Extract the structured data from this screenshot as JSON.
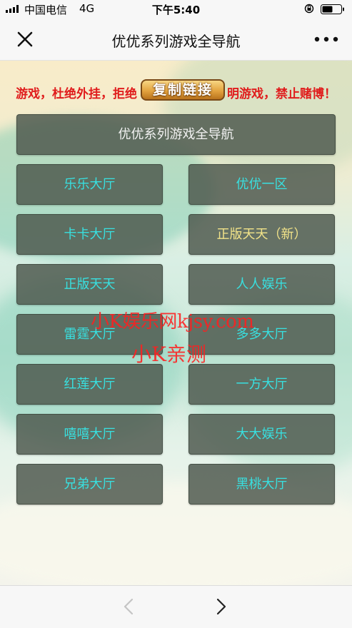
{
  "status_bar": {
    "carrier": "中国电信",
    "network": "4G",
    "time": "下午5:40"
  },
  "nav": {
    "title": "优优系列游戏全导航",
    "close_icon": "close-icon",
    "more_icon": "more-icon"
  },
  "notice": {
    "left_text": "游戏，杜绝外挂，拒绝",
    "right_text": "明游戏，禁止赌博！",
    "color": "#e01c1c"
  },
  "copy_button": {
    "label": "复制链接"
  },
  "main_button": {
    "label": "优优系列游戏全导航"
  },
  "games": [
    {
      "label": "乐乐大厅"
    },
    {
      "label": "优优一区"
    },
    {
      "label": "卡卡大厅"
    },
    {
      "label": "正版天天（新）"
    },
    {
      "label": "正版天天"
    },
    {
      "label": "人人娱乐"
    },
    {
      "label": "雷霆大厅"
    },
    {
      "label": "多多大厅"
    },
    {
      "label": "红莲大厅"
    },
    {
      "label": "一方大厅"
    },
    {
      "label": "嘻嘻大厅"
    },
    {
      "label": "大大娱乐"
    },
    {
      "label": "兄弟大厅"
    },
    {
      "label": "黑桃大厅"
    }
  ],
  "watermark": {
    "line1": "小K娱乐网kjsy.com",
    "line2": "小K亲测"
  },
  "colors": {
    "game_label": "#38e0e0",
    "new_label": "#f2e389",
    "button_bg": "#4e584e"
  },
  "toolbar": {
    "back_icon": "chevron-left-icon",
    "forward_icon": "chevron-right-icon"
  }
}
